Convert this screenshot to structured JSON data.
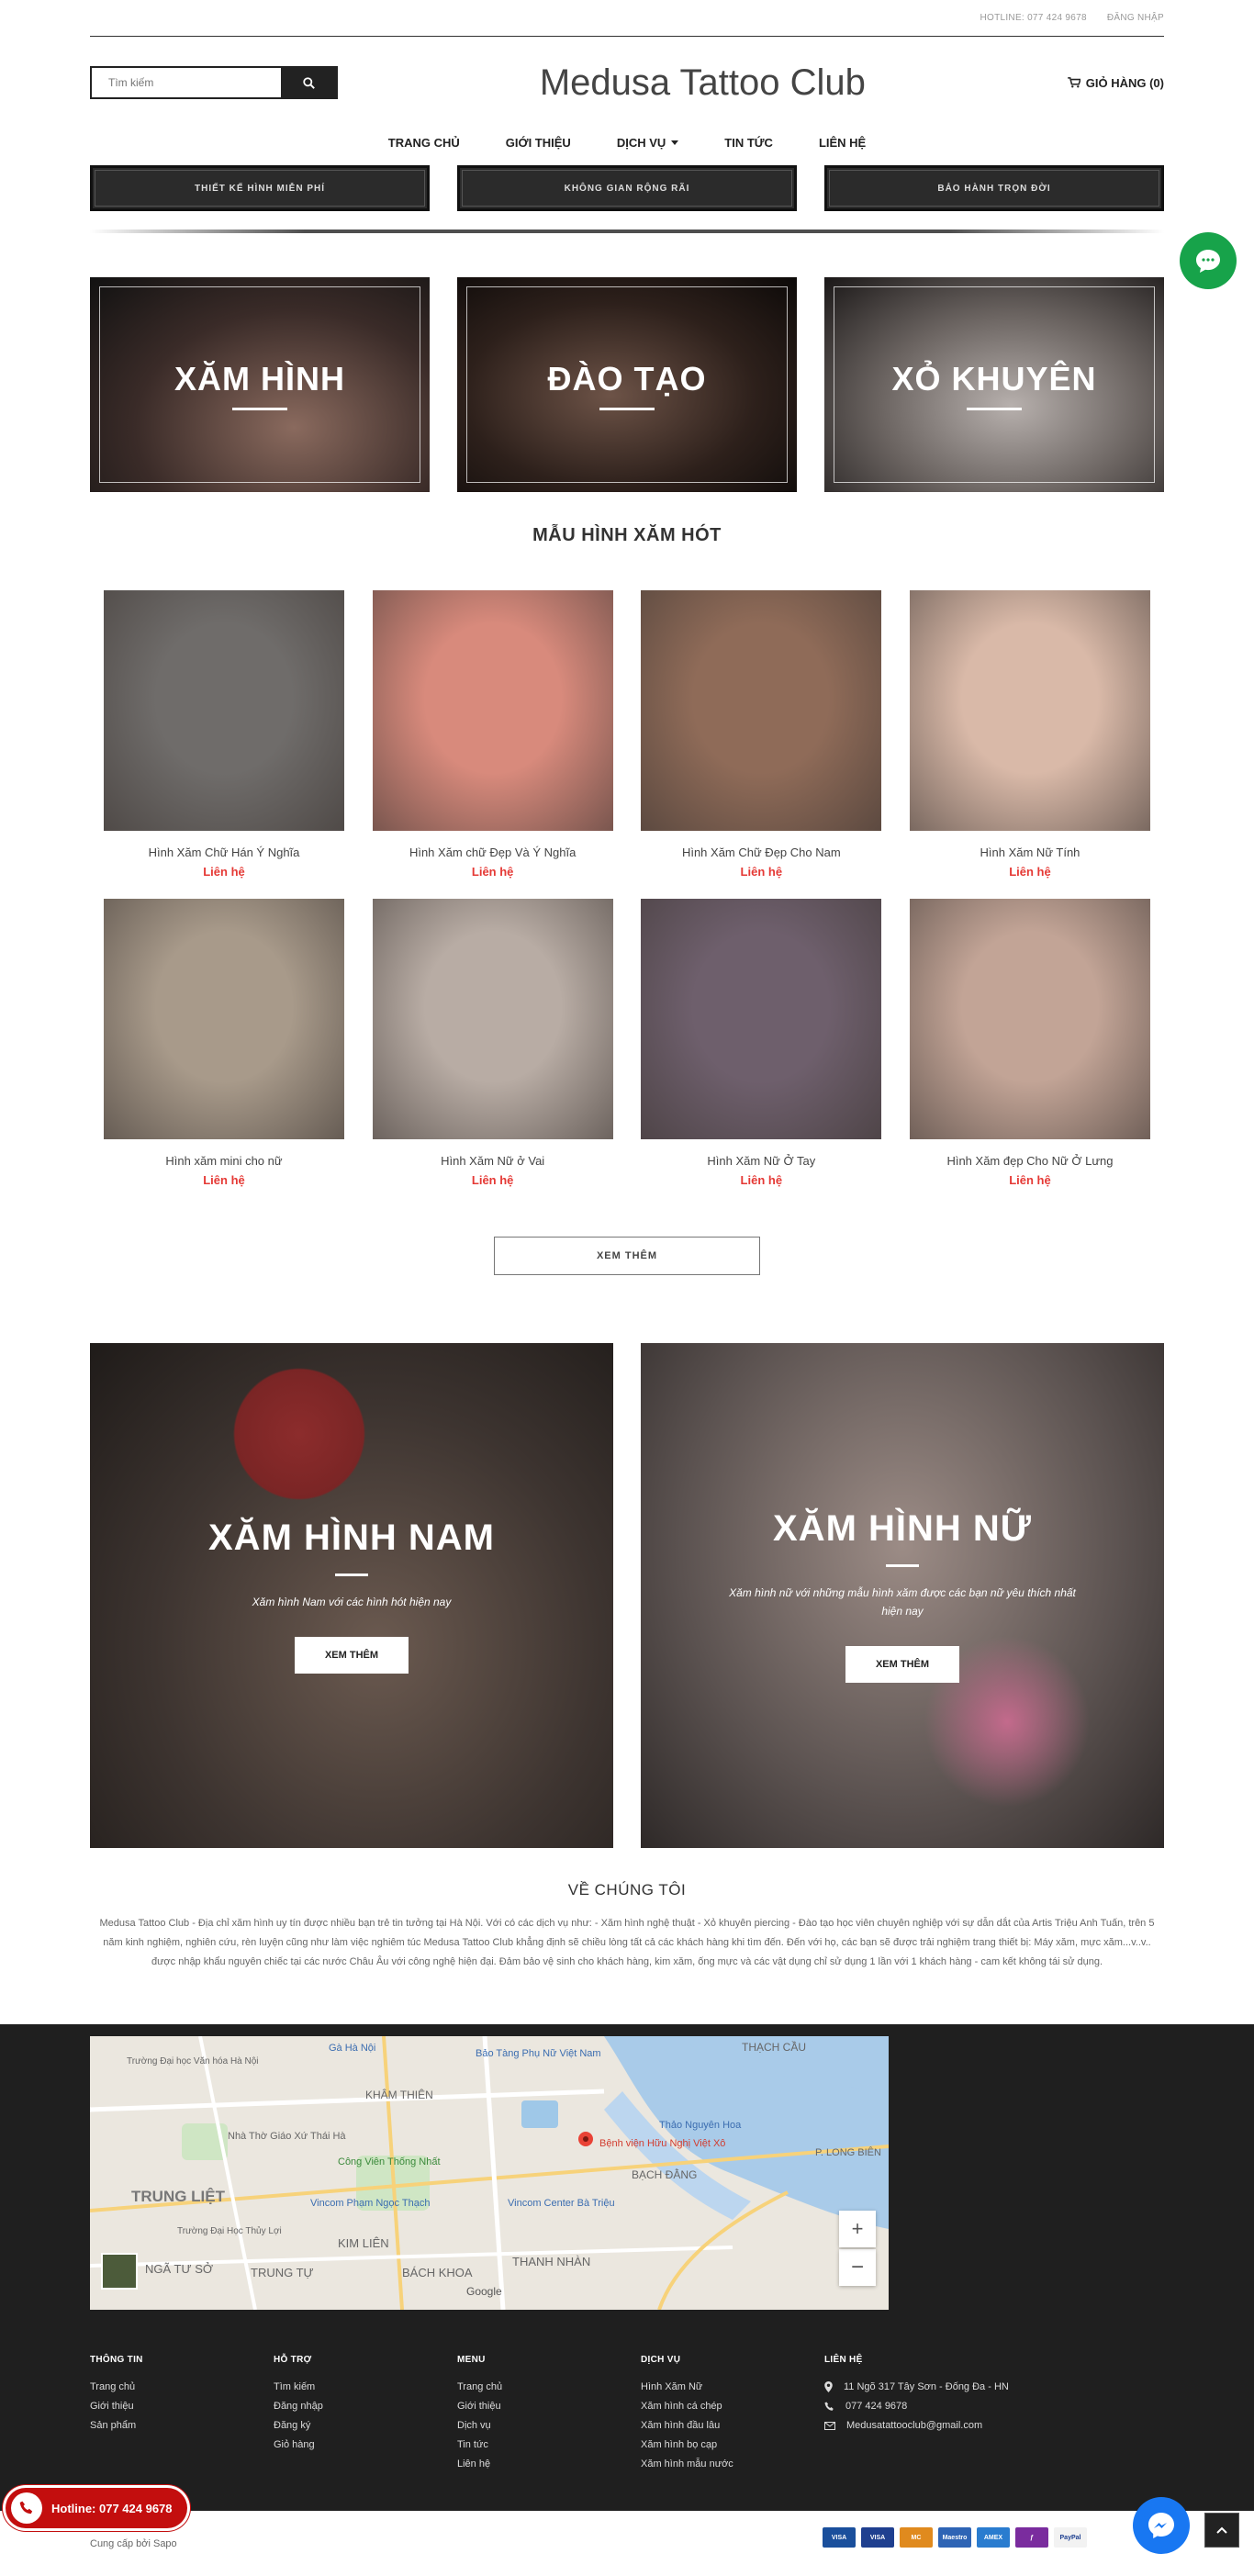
{
  "topbar": {
    "hotline": "HOTLINE: 077 424 9678",
    "login": "ĐĂNG NHẬP"
  },
  "header": {
    "search_placeholder": "Tìm kiếm",
    "logo": "Medusa Tattoo Club",
    "cart": "GIỎ HÀNG (0)"
  },
  "nav": [
    {
      "label": "TRANG CHỦ"
    },
    {
      "label": "GIỚI THIỆU"
    },
    {
      "label": "DỊCH VỤ"
    },
    {
      "label": "TIN TỨC"
    },
    {
      "label": "LIÊN HỆ"
    }
  ],
  "promos": [
    "THIẾT KẾ HÌNH MIỄN PHÍ",
    "KHÔNG GIAN RỘNG RÃI",
    "BẢO HÀNH TRỌN ĐỜI"
  ],
  "banners": [
    "XĂM HÌNH",
    "ĐÀO TẠO",
    "XỎ KHUYÊN"
  ],
  "hot_title": "MẪU HÌNH XĂM HÓT",
  "products": [
    {
      "name": "Hình Xăm Chữ Hán Ý Nghĩa",
      "price": "Liên hệ",
      "bg": "#6f6c6a"
    },
    {
      "name": "Hình Xăm chữ Đẹp Và Ý Nghĩa",
      "price": "Liên hệ",
      "bg": "#d88a7c"
    },
    {
      "name": "Hình Xăm Chữ Đẹp Cho Nam",
      "price": "Liên hệ",
      "bg": "#8f6b58"
    },
    {
      "name": "Hình Xăm Nữ Tính",
      "price": "Liên hệ",
      "bg": "#d9b9a8"
    },
    {
      "name": "Hình xăm mini cho nữ",
      "price": "Liên hệ",
      "bg": "#a89a8a"
    },
    {
      "name": "Hình Xăm Nữ ở Vai",
      "price": "Liên hệ",
      "bg": "#b8aca4"
    },
    {
      "name": "Hình Xăm Nữ Ở Tay",
      "price": "Liên hệ",
      "bg": "#6e5f6c"
    },
    {
      "name": "Hình Xăm đẹp Cho Nữ Ở Lưng",
      "price": "Liên hệ",
      "bg": "#c2a496"
    }
  ],
  "more_button": "XEM THÊM",
  "gender": [
    {
      "title": "XĂM HÌNH NAM",
      "subtitle": "Xăm hình Nam với các hình hót hiện nay",
      "button": "XEM THÊM"
    },
    {
      "title": "XĂM HÌNH NỮ",
      "subtitle": "Xăm hình nữ với những mẫu hình xăm được các bạn nữ yêu thích nhất hiện nay",
      "button": "XEM THÊM"
    }
  ],
  "about": {
    "title": "VỀ CHÚNG TÔI",
    "text": "Medusa Tattoo Club - Địa chỉ xăm hình uy tín được nhiều bạn trẻ tin tưởng tại Hà Nội. Với có các dịch vụ như: - Xăm hình nghệ thuật - Xỏ khuyên piercing - Đào tạo học viên chuyên nghiệp với sự dẫn dắt của Artis Triệu Anh Tuấn, trên 5 năm kinh nghiệm, nghiên cứu, rèn luyện cũng như làm việc nghiêm túc Medusa Tattoo Club khẳng định sẽ chiều lòng tất cả các khách hàng khi tìm đến. Đến với họ, các bạn sẽ được trải nghiệm trang thiết bị: Máy xăm, mực xăm...v..v.. được nhập khẩu nguyên chiếc tại các nước Châu Âu với công nghệ hiện đại. Đảm bảo vệ sinh cho khách hàng, kim xăm, ống mực và các vật dụng chỉ sử dụng 1 lần với 1 khách hàng - cam kết không tái sử dụng."
  },
  "map_labels": [
    "Gà Hà Nội",
    "Bảo Tàng Phụ Nữ Việt Nam",
    "THẠCH CẦU",
    "Trường Đại học Văn hóa Hà Nội",
    "KHÂM THIÊN",
    "Thảo Nguyên Hoa",
    "P. LONG BIÊN",
    "Nhà Thờ Giáo Xứ Thái Hà",
    "Công Viên Thống Nhất",
    "Bệnh viện Hữu Nghị Việt Xô",
    "BẠCH ĐẰNG",
    "TRUNG LIỆT",
    "Vincom Phạm Ngọc Thạch",
    "Vincom Center Bà Triệu",
    "Trường Đại Học Thủy Lợi",
    "KIM LIÊN",
    "NGÃ TƯ SỞ",
    "TRUNG TỰ",
    "BÁCH KHOA",
    "THANH NHÀN",
    "Google"
  ],
  "footer": {
    "columns": [
      {
        "title": "THÔNG TIN",
        "items": [
          "Trang chủ",
          "Giới thiệu",
          "Sản phẩm"
        ]
      },
      {
        "title": "HỖ TRỢ",
        "items": [
          "Tìm kiếm",
          "Đăng nhập",
          "Đăng ký",
          "Giỏ hàng"
        ]
      },
      {
        "title": "MENU",
        "items": [
          "Trang chủ",
          "Giới thiệu",
          "Dịch vụ",
          "Tin tức",
          "Liên hệ"
        ]
      },
      {
        "title": "DỊCH VỤ",
        "items": [
          "Hình Xăm Nữ",
          "Xăm hình cá chép",
          "Xăm hình đầu lâu",
          "Xăm hình bọ cạp",
          "Xăm hình mẫu nước"
        ]
      }
    ],
    "contact": {
      "title": "LIÊN HỆ",
      "address": "11 Ngõ 317 Tây Sơn - Đống Đa - HN",
      "phone": "077 424 9678",
      "email": "Medusatattooclub@gmail.com"
    },
    "copyright": "Cung cấp bởi Sapo",
    "payments": [
      {
        "label": "VISA",
        "color": "#1a4f9c"
      },
      {
        "label": "VISA",
        "color": "#1f3f8f"
      },
      {
        "label": "MC",
        "color": "#e08a1e"
      },
      {
        "label": "Maestro",
        "color": "#2e64b5"
      },
      {
        "label": "AMEX",
        "color": "#2a7ccf"
      },
      {
        "label": "ƒ",
        "color": "#7a2c9e"
      },
      {
        "label": "PayPal",
        "color": "#f2f2f2"
      }
    ]
  },
  "hotline_float": "Hotline: 077 424 9678"
}
